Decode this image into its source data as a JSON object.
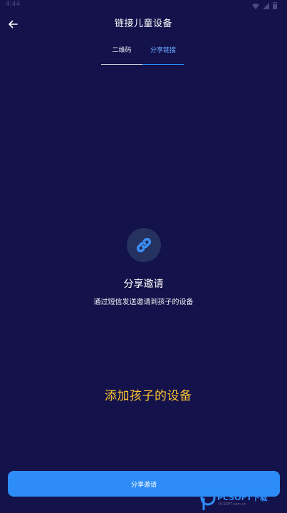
{
  "status_bar": {
    "time": "4:44"
  },
  "header": {
    "title": "链接儿童设备"
  },
  "tabs": [
    {
      "label": "二维码",
      "active": false
    },
    {
      "label": "分享链接",
      "active": true
    }
  ],
  "content": {
    "icon": "link-icon",
    "title": "分享邀请",
    "description": "通过短信发送邀请到孩子的设备"
  },
  "caption": "添加孩子的设备",
  "bottom_button": {
    "label": "分享邀请"
  },
  "watermark": {
    "brand": "PCSOFT下载",
    "sub": "PCSOFT.com.cn"
  },
  "colors": {
    "background": "#14124a",
    "accent": "#2d8cf7",
    "caption": "#ffc42e",
    "icon_circle": "#25315e"
  }
}
